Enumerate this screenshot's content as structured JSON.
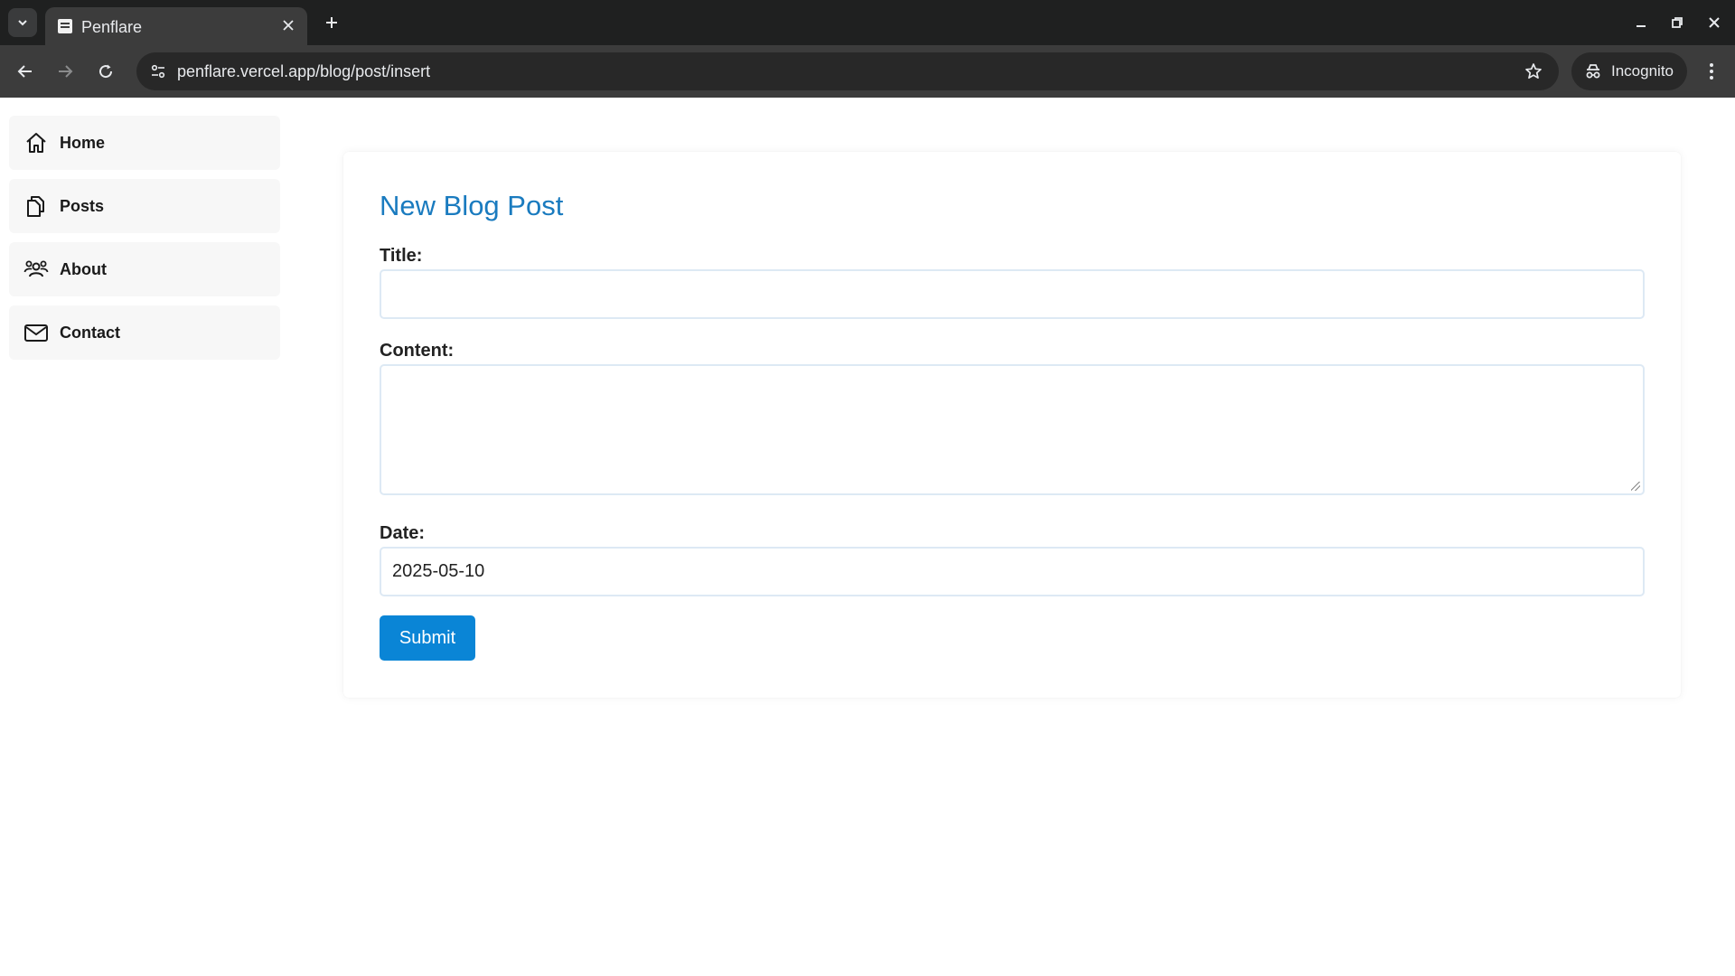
{
  "browser": {
    "tab_title": "Penflare",
    "url": "penflare.vercel.app/blog/post/insert",
    "incognito_label": "Incognito"
  },
  "sidebar": {
    "items": [
      {
        "label": "Home",
        "icon": "home-icon"
      },
      {
        "label": "Posts",
        "icon": "documents-icon"
      },
      {
        "label": "About",
        "icon": "users-icon"
      },
      {
        "label": "Contact",
        "icon": "mail-icon"
      }
    ]
  },
  "form": {
    "heading": "New Blog Post",
    "title_label": "Title:",
    "title_value": "",
    "content_label": "Content:",
    "content_value": "",
    "date_label": "Date:",
    "date_value": "2025-05-10",
    "submit_label": "Submit"
  },
  "colors": {
    "heading": "#1a7bbf",
    "button": "#0a85d6",
    "chrome_dark": "#1f2020",
    "chrome_toolbar": "#3c3c3c"
  }
}
